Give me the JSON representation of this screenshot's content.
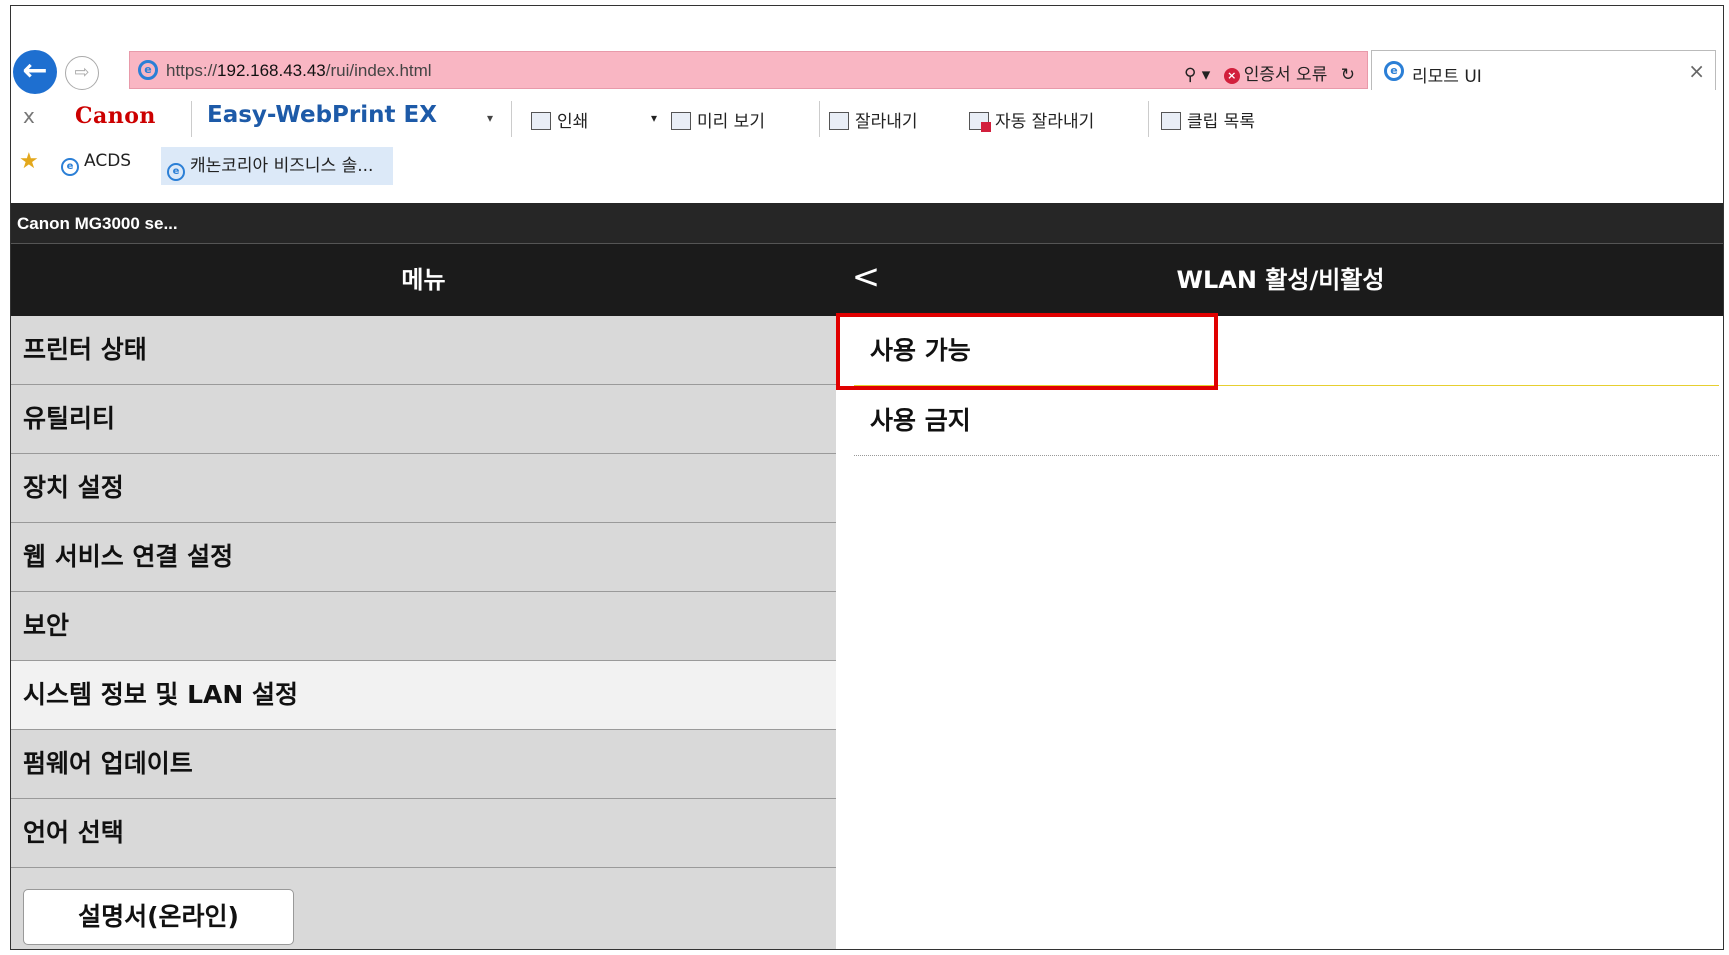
{
  "browser": {
    "url_prefix": "https://",
    "url_host": "192.168.43.43",
    "url_path": "/rui/index.html",
    "search_glyph": "⚲ ▾",
    "cert_error": "인증서 오류",
    "refresh_glyph": "↻",
    "tab_title": "리모트 UI",
    "tab_close": "×",
    "back_glyph": "←",
    "forward_glyph": "⇨"
  },
  "toolbar": {
    "close": "x",
    "canon": "Canon",
    "easy_webprint": "Easy-WebPrint EX",
    "dropdown_glyph": "▾",
    "print": "인쇄",
    "preview_arrow": "▾",
    "preview": "미리 보기",
    "clip": "잘라내기",
    "auto_clip": "자동 잘라내기",
    "clip_list": "클립 목록"
  },
  "favorites": {
    "star_glyph": "★",
    "items": [
      "ACDS",
      "캐논코리아 비즈니스 솔..."
    ]
  },
  "printer": {
    "title": "Canon MG3000 se..."
  },
  "menu": {
    "title": "메뉴",
    "items": [
      "프린터 상태",
      "유틸리티",
      "장치 설정",
      "웹 서비스 연결 설정",
      "보안",
      "시스템 정보 및 LAN 설정",
      "펌웨어 업데이트",
      "언어 선택"
    ],
    "manual_button": "설명서(온라인)"
  },
  "panel": {
    "back_glyph": "<",
    "title": "WLAN 활성/비활성",
    "options": [
      "사용 가능",
      "사용 금지"
    ]
  },
  "colors": {
    "url_bar_error": "#f9b6c3",
    "header": "#1b1b1b",
    "menu_bg": "#d9d9d9",
    "highlight": "#e00000",
    "canon_red": "#cc0000"
  }
}
